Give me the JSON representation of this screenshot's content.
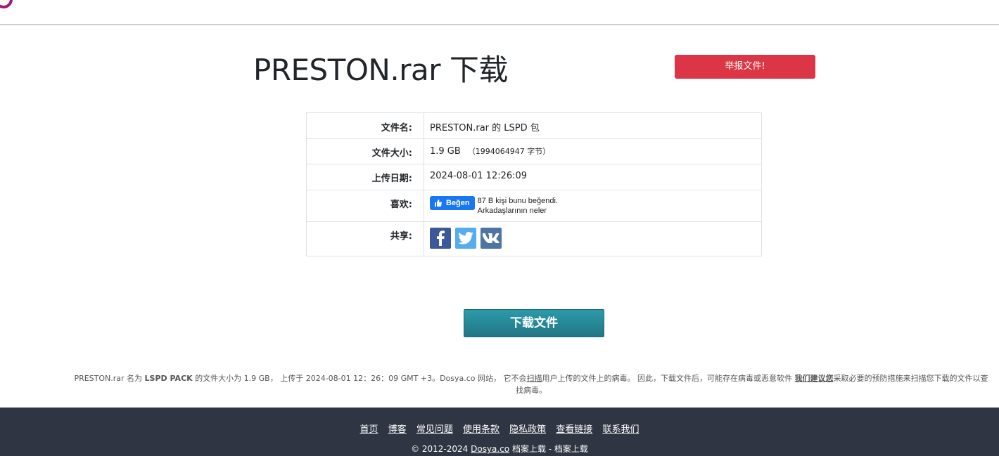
{
  "header": {
    "logo": "logo-mark"
  },
  "title": "PRESTON.rar 下载",
  "report_button": "举报文件!",
  "info": {
    "file_name_label": "文件名:",
    "file_name_value": "PRESTON.rar 的 LSPD 包",
    "file_size_label": "文件大小:",
    "file_size_value": "1.9 GB",
    "file_size_bytes": "（1994064947 字节）",
    "upload_date_label": "上传日期:",
    "upload_date_value": "2024-08-01 12:26:09",
    "like_label": "喜欢:",
    "like_button": "Beğen",
    "like_text_line1": "87 B kişi bunu beğendi.",
    "like_text_line2": "Arkadaşlarının neler",
    "share_label": "共享:",
    "share_icons": [
      "facebook-icon",
      "twitter-icon",
      "vk-icon"
    ]
  },
  "download_button": "下载文件",
  "notice": {
    "p1": "PRESTON.rar 名为 ",
    "bold": "LSPD PACK",
    "p2": " 的文件大小为 1.9 GB， 上传于 2024-08-01 12：26：09 GMT +3。Dosya.co 网站， 它不会",
    "scan": "扫描",
    "p3": "用户上传的文件上的病毒。 因此，下载文件后，可能存在病毒或恶意软件 ",
    "advice": "我们建议您",
    "p4": "采取必要的预防措施来扫描您下载的文件以查找病毒。"
  },
  "footer": {
    "links": [
      "首页",
      "博客",
      "常见问题",
      "使用条款",
      "隐私政策",
      "查看链接",
      "联系我们"
    ],
    "copyright_prefix": "© 2012-2024 ",
    "copyright_link": "Dosya.co",
    "copyright_suffix": " 档案上载 - 档案上载"
  },
  "colors": {
    "report": "#dc3545",
    "download": "#237684",
    "footer_bg": "#2f3542",
    "facebook": "#3b5998",
    "twitter": "#55acee",
    "vk": "#4c75a3",
    "fb_like": "#1877f2"
  }
}
